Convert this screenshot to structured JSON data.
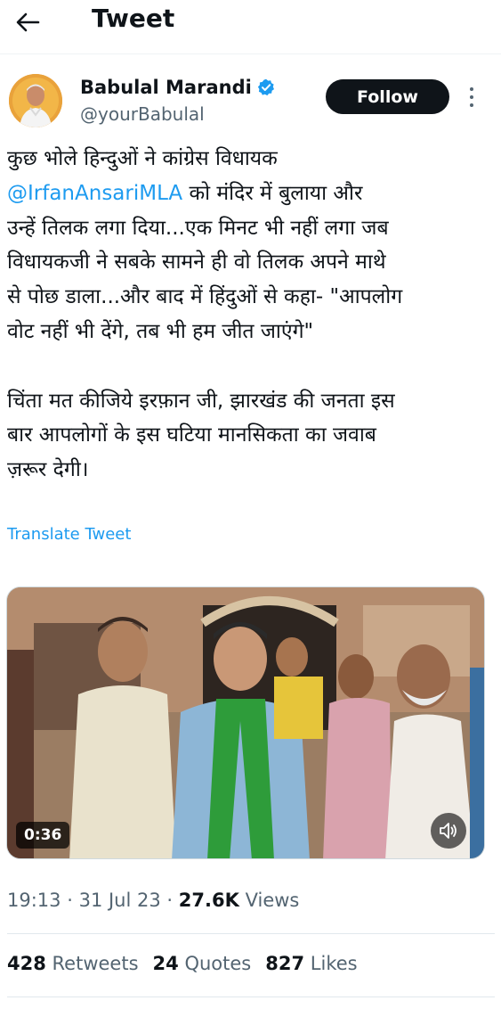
{
  "header": {
    "title": "Tweet",
    "back_icon": "arrow-left-icon"
  },
  "author": {
    "name": "Babulal Marandi",
    "handle": "@yourBabulal",
    "verified_icon": "verified-badge-icon",
    "follow_label": "Follow",
    "more_icon": "more-vertical-icon"
  },
  "tweet": {
    "lines": [
      "कुछ भोले हिन्दुओं ने कांग्रेस विधायक",
      "को मंदिर में बुलाया और",
      "उन्हें तिलक लगा दिया...एक मिनट भी नहीं लगा जब",
      "विधायकजी ने सबके सामने ही वो तिलक अपने माथे",
      "से पोछ डाला...और बाद में हिंदुओं से कहा- \"आपलोग",
      "वोट नहीं भी देंगे, तब भी हम जीत जाएंगे\"",
      "चिंता मत कीजिये इरफ़ान जी, झारखंड की जनता इस",
      "बार आपलोगों के इस घटिया मानसिकता का जवाब",
      "ज़रूर देगी।"
    ],
    "mention": "@IrfanAnsariMLA",
    "translate_label": "Translate Tweet"
  },
  "media": {
    "video_time": "0:36",
    "mute_icon": "speaker-icon"
  },
  "meta": {
    "time": "19:13",
    "date": "31 Jul 23",
    "views_count": "27.6K",
    "views_label": "Views",
    "separator": "·"
  },
  "stats": {
    "retweets_count": "428",
    "retweets_label": "Retweets",
    "quotes_count": "24",
    "quotes_label": "Quotes",
    "likes_count": "827",
    "likes_label": "Likes"
  },
  "colors": {
    "link": "#1d9bf0",
    "text": "#0f1419",
    "secondary": "#536471",
    "button": "#0f1419"
  }
}
